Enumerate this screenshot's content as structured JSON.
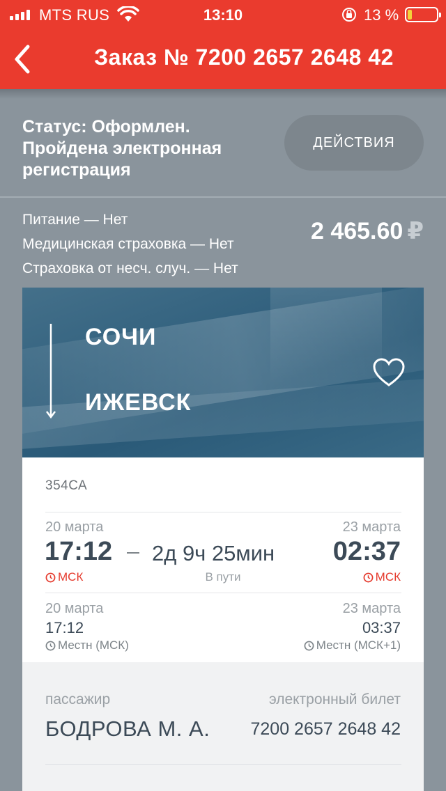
{
  "status_bar": {
    "carrier": "MTS RUS",
    "time": "13:10",
    "battery_percent": "13 %"
  },
  "header": {
    "title": "Заказ № 7200 2657 2648 42"
  },
  "order": {
    "status_line1": "Статус: Оформлен.",
    "status_line2": "Пройдена электронная",
    "status_line3": "регистрация",
    "actions_label": "ДЕЙСТВИЯ",
    "options": [
      "Питание — Нет",
      "Медицинская страховка — Нет",
      "Страховка от несч. случ. — Нет"
    ],
    "price": "2 465.60",
    "currency": "₽"
  },
  "route": {
    "from": "СОЧИ",
    "to": "ИЖЕВСК"
  },
  "trip": {
    "train_number": "354СА",
    "departure_date": "20 марта",
    "departure_time": "17:12",
    "departure_tz": "МСК",
    "arrival_date": "23 марта",
    "arrival_time": "02:37",
    "arrival_tz": "МСК",
    "duration": "2д 9ч 25мин",
    "duration_label": "В пути",
    "local_departure_date": "20 марта",
    "local_departure_time": "17:12",
    "local_departure_tz": "Местн (МСК)",
    "local_arrival_date": "23 марта",
    "local_arrival_time": "03:37",
    "local_arrival_tz": "Местн (МСК+1)"
  },
  "passenger": {
    "label": "пассажир",
    "name": "БОДРОВА М. А.",
    "ticket_label": "электронный билет",
    "ticket_number": "7200 2657 2648 42"
  },
  "colors": {
    "brand_red": "#ea3b2e",
    "text_dark": "#3c4a57",
    "background": "#8a949c"
  }
}
